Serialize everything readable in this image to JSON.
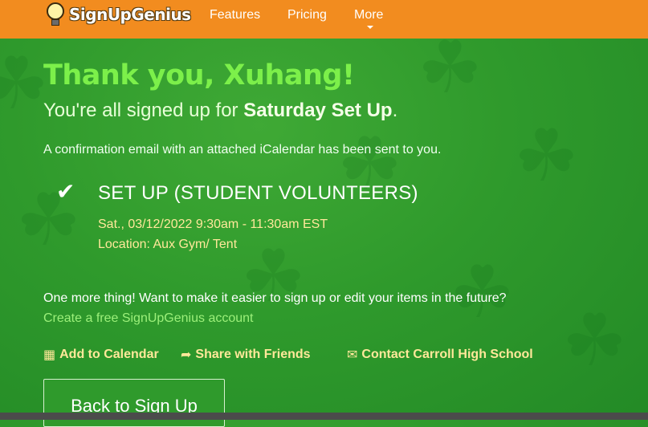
{
  "navbar": {
    "logo_text": "SignUpGenius",
    "links": [
      "Features",
      "Pricing",
      "More"
    ]
  },
  "confirmation": {
    "heading": "Thank you, Xuhang!",
    "sub_prefix": "You're all signed up for ",
    "signup_name": "Saturday Set Up",
    "sub_suffix": ".",
    "email_note": "A confirmation email with an attached iCalendar has been sent to you."
  },
  "slot": {
    "title": "SET UP (STUDENT VOLUNTEERS)",
    "datetime": "Sat., 03/12/2022 9:30am - 11:30am EST",
    "location": "Location: Aux Gym/ Tent"
  },
  "account_prompt": {
    "text": "One more thing! Want to make it easier to sign up or edit your items in the future?",
    "link": "Create a free SignUpGenius account"
  },
  "actions": {
    "calendar": "Add to Calendar",
    "share": "Share with Friends",
    "contact": "Contact Carroll High School"
  },
  "back_button": "Back to Sign Up",
  "colors": {
    "navbar": "#f28c1f",
    "background": "#2f9a2c",
    "heading": "#7cf04a",
    "highlight": "#ffe89a"
  }
}
